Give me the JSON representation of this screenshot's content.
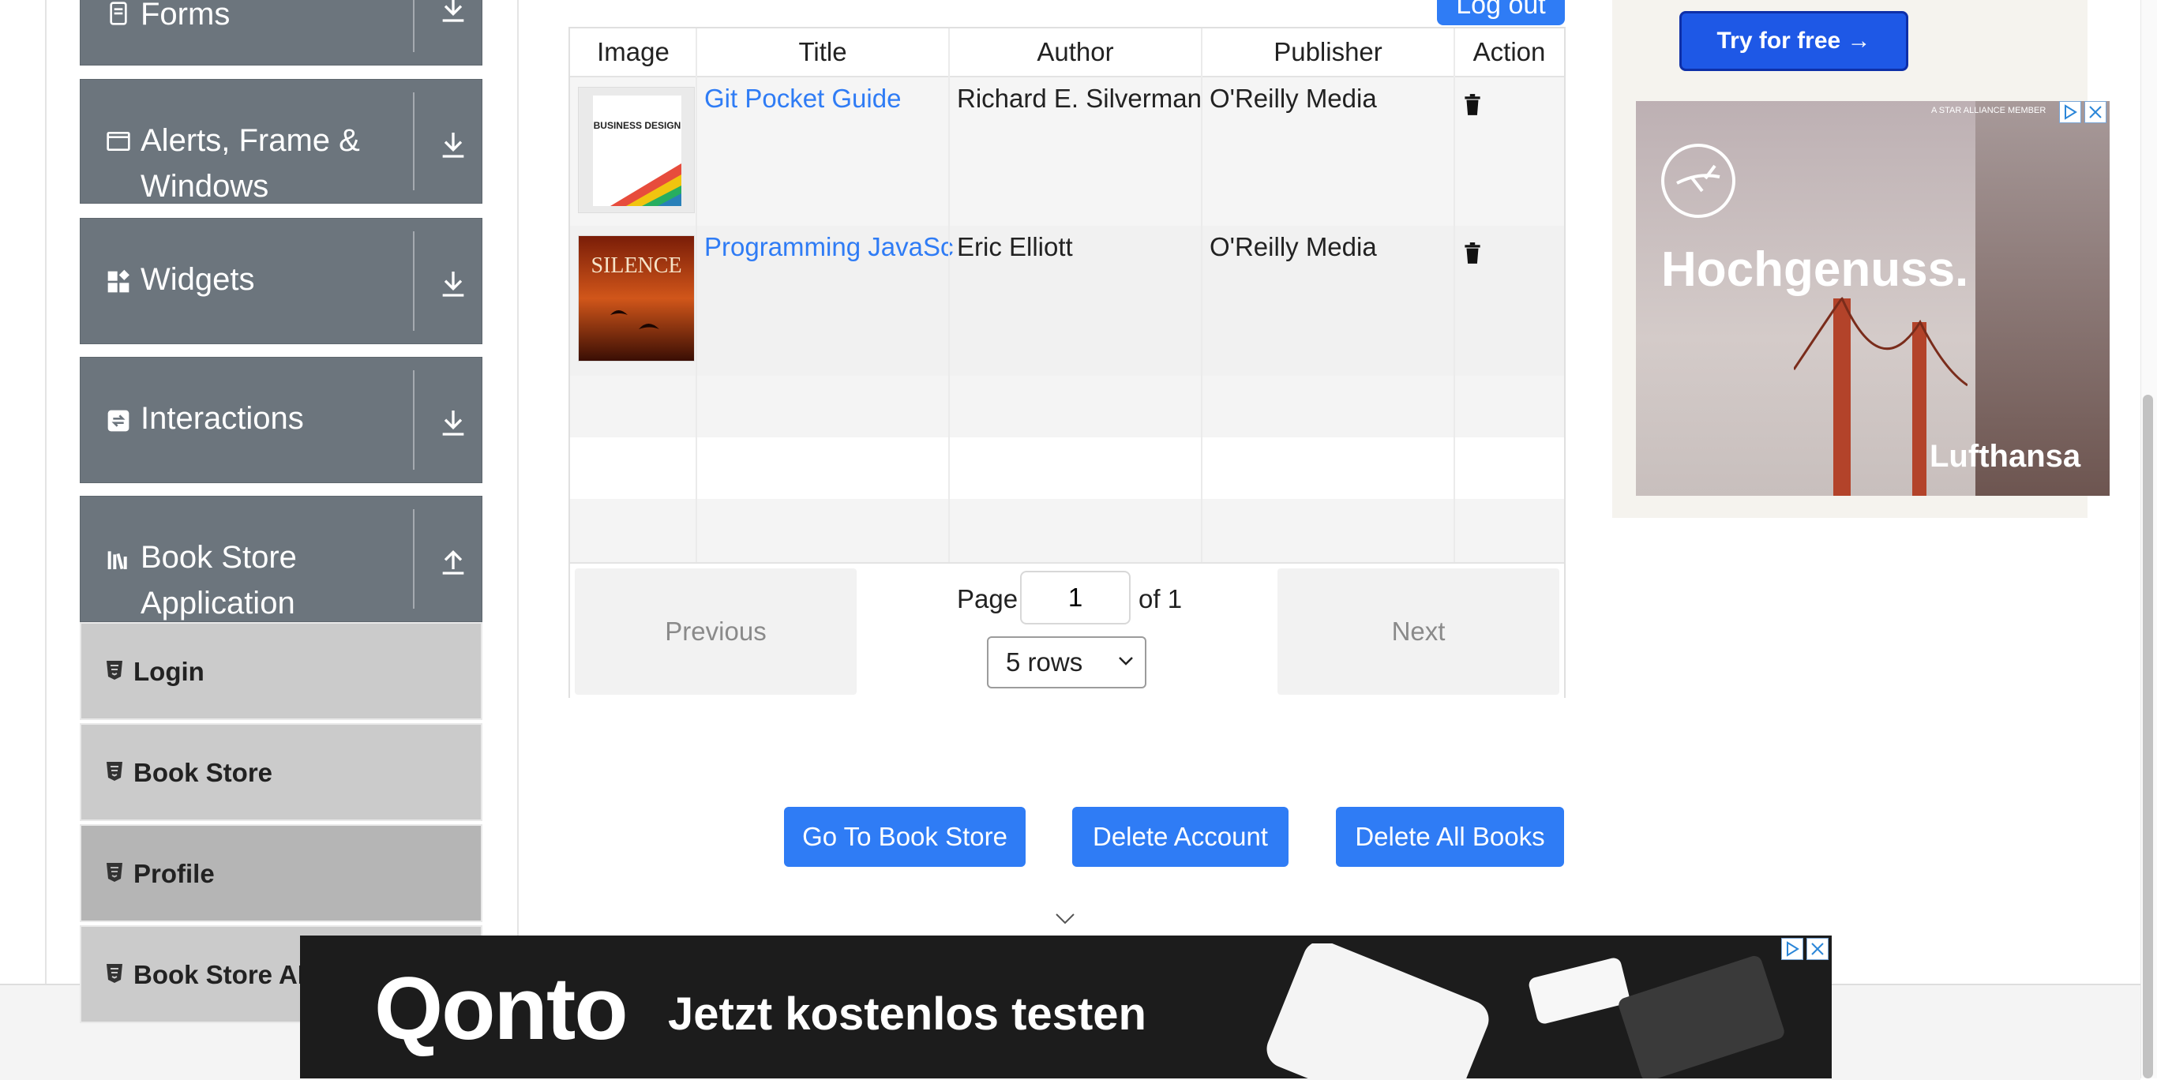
{
  "sidebar": {
    "groups": [
      {
        "label": "Forms",
        "expanded": false
      },
      {
        "label": "Alerts, Frame & Windows",
        "expanded": false
      },
      {
        "label": "Widgets",
        "expanded": false
      },
      {
        "label": "Interactions",
        "expanded": false
      },
      {
        "label": "Book Store Application",
        "expanded": true
      }
    ],
    "sub_items": [
      {
        "label": "Login",
        "active": false
      },
      {
        "label": "Book Store",
        "active": false
      },
      {
        "label": "Profile",
        "active": true
      },
      {
        "label": "Book Store API",
        "active": false
      }
    ]
  },
  "header": {
    "logout_label": "Log out"
  },
  "table": {
    "columns": [
      "Image",
      "Title",
      "Author",
      "Publisher",
      "Action"
    ],
    "rows": [
      {
        "cover_text": "BUSINESS DESIGN",
        "title": "Git Pocket Guide",
        "author": "Richard E. Silverman",
        "publisher": "O'Reilly Media"
      },
      {
        "cover_text": "SILENCE",
        "title": "Programming JavaScript Applications",
        "author": "Eric Elliott",
        "publisher": "O'Reilly Media"
      }
    ]
  },
  "pagination": {
    "previous_label": "Previous",
    "next_label": "Next",
    "page_label": "Page",
    "current_page": "1",
    "of_label": "of 1",
    "rows_option": "5 rows"
  },
  "actions": {
    "go_to_store": "Go To Book Store",
    "delete_account": "Delete Account",
    "delete_all_books": "Delete All Books"
  },
  "ads": {
    "right": {
      "cta": "Try for free →",
      "tagline": "A STAR ALLIANCE MEMBER",
      "headline": "Hochgenuss.",
      "brand": "Lufthansa"
    },
    "bottom": {
      "logo": "Qonto",
      "text": "Jetzt kostenlos testen"
    }
  },
  "colors": {
    "primary": "#2f7cf5",
    "sidebar_group": "#6c757d",
    "sidebar_sub": "#cbcbcb",
    "sidebar_sub_active": "#b5b5b5"
  }
}
